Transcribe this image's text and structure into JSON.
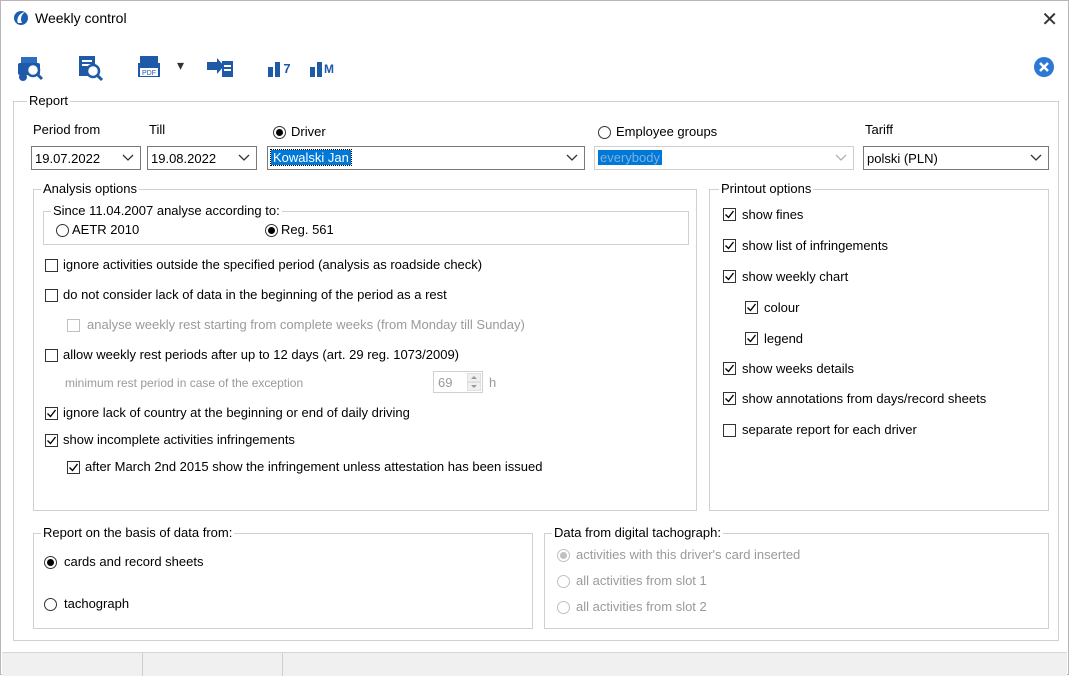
{
  "window": {
    "title": "Weekly control",
    "close": "✕"
  },
  "toolbar": {
    "dropdown_arrow": "▾"
  },
  "report": {
    "group_label": "Report",
    "period_from_label": "Period from",
    "till_label": "Till",
    "period_from": "19.07.2022",
    "till": "19.08.2022",
    "driver_label": "Driver",
    "driver_value": "Kowalski Jan",
    "employee_groups_label": "Employee groups",
    "employee_groups_value": "everybody",
    "tariff_label": "Tariff",
    "tariff_value": "polski (PLN)"
  },
  "analysis": {
    "group_label": "Analysis options",
    "since_label": "Since 11.04.2007 analyse according to:",
    "aetr": "AETR 2010",
    "reg561": "Reg. 561",
    "opt1": "ignore activities outside the specified period (analysis as roadside check)",
    "opt2": "do not consider lack of data in the beginning of the period as a rest",
    "opt2a": "analyse weekly rest starting from complete weeks (from Monday till Sunday)",
    "opt3": "allow weekly rest periods after up to 12 days (art. 29 reg. 1073/2009)",
    "min_rest_label": "minimum rest period in case of the exception",
    "min_rest_value": "69",
    "min_rest_unit": "h",
    "opt4": "ignore lack of country at the beginning or end of daily driving",
    "opt5": "show incomplete activities infringements",
    "opt5a": "after March 2nd 2015 show the infringement unless attestation has been issued"
  },
  "printout": {
    "group_label": "Printout options",
    "show_fines": "show fines",
    "show_list": "show list of infringements",
    "show_weekly_chart": "show weekly chart",
    "colour": "colour",
    "legend": "legend",
    "show_weeks_details": "show weeks details",
    "show_annotations": "show annotations from days/record sheets",
    "separate_report": "separate report for each driver"
  },
  "basis": {
    "group_label": "Report on the basis of data from:",
    "cards": "cards and record sheets",
    "tachograph": "tachograph"
  },
  "digital": {
    "group_label": "Data from digital tachograph:",
    "opt1": "activities with this driver's card inserted",
    "opt2": "all activities from slot 1",
    "opt3": "all activities from slot 2"
  },
  "colors": {
    "accent": "#1a5fb4",
    "selection": "#0078d7"
  }
}
